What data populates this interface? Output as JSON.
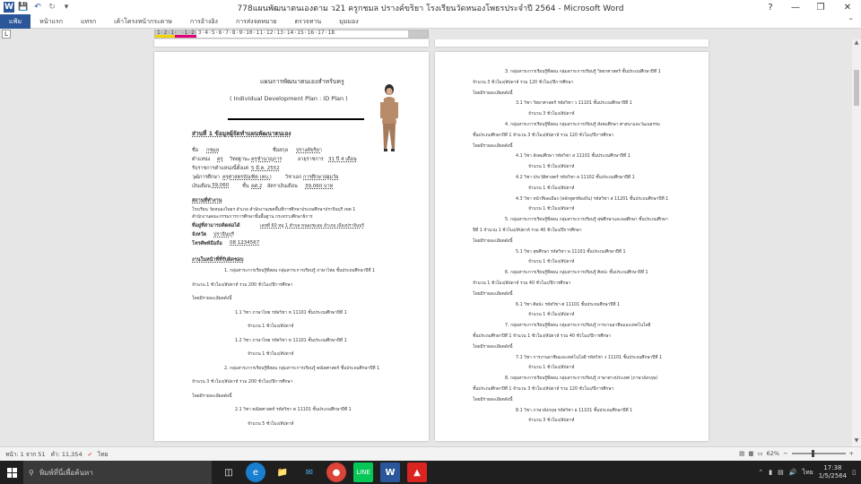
{
  "window": {
    "title": "778แผนพัฒนาตนเองตาม ว21 ครูกชมล ปรางค์ขริยา โรงเรียนวัดหนองโพธรประจำปี 2564 - Microsoft Word",
    "quick_access": [
      "word-icon",
      "save-icon",
      "undo-icon",
      "redo-icon",
      "customize-icon"
    ],
    "controls": [
      "minimize-icon",
      "restore-icon",
      "close-icon"
    ]
  },
  "ribbon": {
    "tabs": [
      "แฟ้ม",
      "หน้าแรก",
      "แทรก",
      "เค้าโครงหน้ากระดาษ",
      "การอ้างอิง",
      "การส่งจดหมาย",
      "ตรวจทาน",
      "มุมมอง"
    ],
    "active_tab": "แฟ้ม"
  },
  "ruler": {
    "tab_selector": "L",
    "numbers": "1·2·1· ·1·2·3·4·5·6·7·8·9·10·11·12·13·14·15·16·17·18"
  },
  "left_page": {
    "title": "แผนการพัฒนาตนเองสำหรับครู",
    "subtitle": "( Individual  Development  Plan : ID  Plan )",
    "section1": "ส่วนที่ 1  ข้อมูลผู้จัดทำแผนพัฒนาตนเอง",
    "name_label": "ชื่อ",
    "name_value": "กชมล",
    "surname_label": "ชื่อสกุล",
    "surname_value": "ปรางค์ขริยา",
    "position_label": "ตำแหน่ง",
    "position_value": "ครู",
    "rank_label": "วิทยฐานะ",
    "rank_value": "ครูชำนาญการ",
    "age_label": "อายุราชการ",
    "age_value": "31 ปี 4 เดือน",
    "since_label": "รับราชการตำแหน่งนี้ตั้งแต่",
    "since_value": "5 มี.ค. 2552",
    "edu_label": "วุฒิการศึกษา",
    "edu_value": "ครุศาสตรบัณฑิต (คบ.)",
    "major_label": "วิชาเอก",
    "major_value": "การศึกษาปฐมวัย",
    "salary_label": "เงินเดือน",
    "salary_value": "39,060",
    "level_label": "ชั้น",
    "level_value": "คศ.2",
    "pay_label": "อัตราเงินเดือน",
    "pay_value": "39,060 บาท",
    "workplace_header": "สถานที่ทำงาน",
    "school_line": "โรงเรียน วัดหนองโพธร อำเภอ สำนักงานเขตพื้นที่การศึกษาประถมศึกษาปราจีนบุรี เขต 1",
    "office_line": "สำนักงานคณะกรรมการการศึกษาขั้นพื้นฐาน กระทรวงศึกษาธิการ",
    "address_label": "ที่อยู่ที่สามารถติดต่อได้",
    "address_value": "เลขที่ 60 หมู่ 1 ตำบล หนองชะอม อำเภอ เมืองปราจีนบุรี",
    "province_label": "จังหวัด",
    "province_value": "ปราจีนบุรี",
    "phone_label": "โทรศัพท์มือถือ",
    "phone_value": "08 1234567",
    "subjects_header": "งานในหน้าที่ที่รับผิดชอบ",
    "items": [
      {
        "text": "1.  กลุ่มสาระการเรียนรู้ที่สอน  กลุ่มสาระการเรียนรู้ ภาษาไทย  ชั้นประถมศึกษาปีที่ 1",
        "indent": 1
      },
      {
        "text": "จำนวน 1 ชั่วโมง/สัปดาห์   รวม   200 ชั่วโมง/ปีการศึกษา",
        "indent": 0
      },
      {
        "text": "โดยมีรายละเอียดดังนี้",
        "indent": 0
      },
      {
        "text": "1.1   วิชา  ภาษาไทย  รหัสวิชา  ท 11101  ชั้นประถมศึกษาปีที่  1",
        "indent": 2
      },
      {
        "text": "จำนวน  1  ชั่วโมง/สัปดาห์",
        "indent": 3
      },
      {
        "text": "1.2   วิชา  ภาษาไทย  รหัสวิชา  ท 11101  ชั้นประถมศึกษาปีที่  1",
        "indent": 2
      },
      {
        "text": "จำนวน  1  ชั่วโมง/สัปดาห์",
        "indent": 3
      },
      {
        "text": "2.  กลุ่มสาระการเรียนรู้ที่สอน  กลุ่มสาระการเรียนรู้  คณิตศาสตร์  ชั้นประถมศึกษาปีที่ 1",
        "indent": 1
      },
      {
        "text": "จำนวน 3 ชั่วโมง/สัปดาห์   รวม   200 ชั่วโมง/ปีการศึกษา",
        "indent": 0
      },
      {
        "text": "โดยมีรายละเอียดดังนี้",
        "indent": 0
      },
      {
        "text": "2.1   วิชา  คณิตศาสตร์  รหัสวิชา  ค 11101  ชั้นประถมศึกษาปีที่  1",
        "indent": 2
      },
      {
        "text": "จำนวน  5  ชั่วโมง/สัปดาห์",
        "indent": 3
      }
    ]
  },
  "right_page": {
    "items": [
      {
        "text": "3.  กลุ่มสาระการเรียนรู้ที่สอน  กลุ่มสาระการเรียนรู้  วิทยาศาสตร์  ชั้นประถมศึกษาปีที่ 1",
        "indent": 1
      },
      {
        "text": "จำนวน  3  ชั่วโมง/สัปดาห์   รวม   120 ชั่วโมง/ปีการศึกษา",
        "indent": 0
      },
      {
        "text": "โดยมีรายละเอียดดังนี้",
        "indent": 0
      },
      {
        "text": "3.1   วิชา  วิทยาศาสตร์  รหัสวิชา  ว 11101  ชั้นประถมศึกษาปีที่  1",
        "indent": 2
      },
      {
        "text": "จำนวน  3  ชั่วโมง/สัปดาห์",
        "indent": 3
      },
      {
        "text": "4.  กลุ่มสาระการเรียนรู้ที่สอน  กลุ่มสาระการเรียนรู้  สังคมศึกษา ศาสนาและวัฒนธรรม",
        "indent": 1
      },
      {
        "text": "ชั้นประถมศึกษาปีที่  1  จำนวน  3  ชั่วโมง/สัปดาห์   รวม   120 ชั่วโมง/ปีการศึกษา",
        "indent": 0
      },
      {
        "text": "โดยมีรายละเอียดดังนี้",
        "indent": 0
      },
      {
        "text": "4.1   วิชา  สังคมศึกษา  รหัสวิชา  ส 11101  ชั้นประถมศึกษาปีที่  1",
        "indent": 2
      },
      {
        "text": "จำนวน  1  ชั่วโมง/สัปดาห์",
        "indent": 3
      },
      {
        "text": "4.2   วิชา  ประวัติศาสตร์  รหัสวิชา  ส 11102  ชั้นประถมศึกษาปีที่  1",
        "indent": 2
      },
      {
        "text": "จำนวน  1  ชั่วโมง/สัปดาห์",
        "indent": 3
      },
      {
        "text": "4.3   วิชา  หน้าที่พลเมือง (หลักสูตรท้องถิ่น)  รหัสวิชา  ส 11201  ชั้นประถมศึกษาปีที่  1",
        "indent": 2
      },
      {
        "text": "จำนวน  1  ชั่วโมง/สัปดาห์",
        "indent": 3
      },
      {
        "text": "5.  กลุ่มสาระการเรียนรู้ที่สอน  กลุ่มสาระการเรียนรู้  สุขศึกษาและพลศึกษา  ชั้นประถมศึกษา",
        "indent": 1
      },
      {
        "text": "ปีที่  1  จำนวน  1  ชั่วโมง/สัปดาห์   รวม   40 ชั่วโมง/ปีการศึกษา",
        "indent": 0
      },
      {
        "text": "โดยมีรายละเอียดดังนี้",
        "indent": 0
      },
      {
        "text": "5.1   วิชา  สุขศึกษา  รหัสวิชา  พ 11101  ชั้นประถมศึกษาปีที่  1",
        "indent": 2
      },
      {
        "text": "จำนวน  1  ชั่วโมง/สัปดาห์",
        "indent": 3
      },
      {
        "text": "6.  กลุ่มสาระการเรียนรู้ที่สอน  กลุ่มสาระการเรียนรู้  ศิลปะ  ชั้นประถมศึกษาปีที่  1",
        "indent": 1
      },
      {
        "text": "จำนวน  1  ชั่วโมง/สัปดาห์   รวม   40 ชั่วโมง/ปีการศึกษา",
        "indent": 0
      },
      {
        "text": "โดยมีรายละเอียดดังนี้",
        "indent": 0
      },
      {
        "text": "6.1   วิชา  ศิลปะ  รหัสวิชา  ศ 11101  ชั้นประถมศึกษาปีที่  1",
        "indent": 2
      },
      {
        "text": "จำนวน  1  ชั่วโมง/สัปดาห์",
        "indent": 3
      },
      {
        "text": "7.  กลุ่มสาระการเรียนรู้ที่สอน  กลุ่มสาระการเรียนรู้  การงานอาชีพและเทคโนโลยี",
        "indent": 1
      },
      {
        "text": "ชั้นประถมศึกษาปีที่  1  จำนวน  1  ชั่วโมง/สัปดาห์   รวม   40 ชั่วโมง/ปีการศึกษา",
        "indent": 0
      },
      {
        "text": "โดยมีรายละเอียดดังนี้",
        "indent": 0
      },
      {
        "text": "7.1   วิชา  การงานอาชีพและเทคโนโลยี  รหัสวิชา  ง 11101  ชั้นประถมศึกษาปีที่  1",
        "indent": 2
      },
      {
        "text": "จำนวน  1  ชั่วโมง/สัปดาห์",
        "indent": 3
      },
      {
        "text": "8.  กลุ่มสาระการเรียนรู้ที่สอน  กลุ่มสาระการเรียนรู้  ภาษาต่างประเทศ (ภาษาอังกฤษ)",
        "indent": 1
      },
      {
        "text": "ชั้นประถมศึกษาปีที่  1  จำนวน  3  ชั่วโมง/สัปดาห์   รวม   120 ชั่วโมง/ปีการศึกษา",
        "indent": 0
      },
      {
        "text": "โดยมีรายละเอียดดังนี้",
        "indent": 0
      },
      {
        "text": "8.1   วิชา  ภาษาอังกฤษ  รหัสวิชา  อ 11101  ชั้นประถมศึกษาปีที่  1",
        "indent": 2
      },
      {
        "text": "จำนวน  3  ชั่วโมง/สัปดาห์",
        "indent": 3
      }
    ]
  },
  "statusbar": {
    "page": "หน้า: 1 จาก 51",
    "words": "คำ: 11,354",
    "language": "ไทย",
    "zoom": "62%",
    "zoom_fraction": 0.4
  },
  "taskbar": {
    "search_placeholder": "พิมพ์ที่นี่เพื่อค้นหา",
    "apps": [
      "task-view-icon",
      "edge-icon",
      "file-explorer-icon",
      "mail-icon",
      "chrome-icon",
      "line-icon",
      "word-icon",
      "acrobat-icon"
    ],
    "language": "ไทย",
    "time": "17:38",
    "date": "1/5/2564"
  }
}
